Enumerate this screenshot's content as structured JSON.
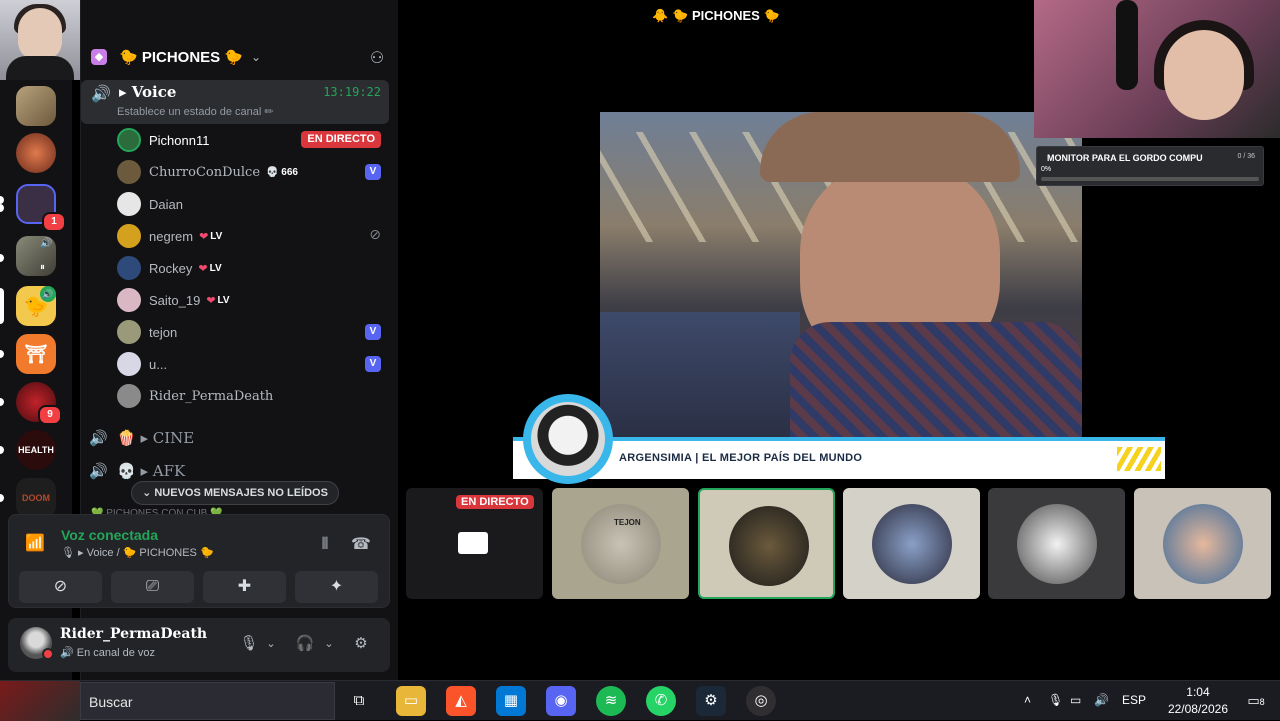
{
  "window": {
    "title": "🐥 🐤 PICHONES 🐤"
  },
  "rail": {
    "badges": {
      "server3": "1",
      "server9": "9"
    },
    "labels": {
      "health": "HEALTH",
      "doom": "DOOM"
    }
  },
  "server": {
    "name": "🐤 PICHONES 🐤"
  },
  "voice_channel": {
    "name": "▸ Voice",
    "timer": "13:19:22",
    "status_placeholder": "Establece un estado de canal ✏",
    "members": [
      {
        "name": "Pichonn11",
        "badge": "EN DIRECTO"
      },
      {
        "name": "ChurroConDulce",
        "tag": "💀 666",
        "extra": "V"
      },
      {
        "name": "Daian"
      },
      {
        "name": "negrem",
        "tag": "LV",
        "extra": "muted"
      },
      {
        "name": "Rockey",
        "tag": "LV"
      },
      {
        "name": "Saito_19",
        "tag": "LV"
      },
      {
        "name": "tejon",
        "extra": "V"
      },
      {
        "name": "u...",
        "extra": "V"
      },
      {
        "name": "Rider_PermaDeath"
      }
    ]
  },
  "channels": [
    {
      "name": "🍿 ▸ CINE"
    },
    {
      "name": "💀 ▸ AFK"
    }
  ],
  "new_messages_label": "NUEVOS MENSAJES NO LEÍDOS",
  "peek_text": "💚 PICHONES CON CUB 💚",
  "voice_panel": {
    "title": "Voz conectada",
    "subtitle": "🎙 ▸ Voice / 🐤 PICHONES 🐤"
  },
  "user_panel": {
    "name": "Rider_PermaDeath",
    "status": "En canal de voz"
  },
  "stream": {
    "lower_third": "ARGENSIMIA | EL MEJOR PAÍS DEL MUNDO",
    "overlay_title": "MONITOR PARA EL GORDO COMPU",
    "overlay_count": "0 / 36",
    "overlay_percent": "0%",
    "overlay_progress": 0
  },
  "tiles": {
    "live_label": "EN DIRECTO",
    "tile2_label": "TEJON"
  },
  "taskbar": {
    "search_label": "Buscar",
    "lang": "ESP",
    "time": "1:04",
    "date": "22/08/2026",
    "notif_count": "8"
  },
  "colors": {
    "accent_green": "#23a55a",
    "live_red": "#da373c",
    "nitro_blue": "#5865f2"
  }
}
